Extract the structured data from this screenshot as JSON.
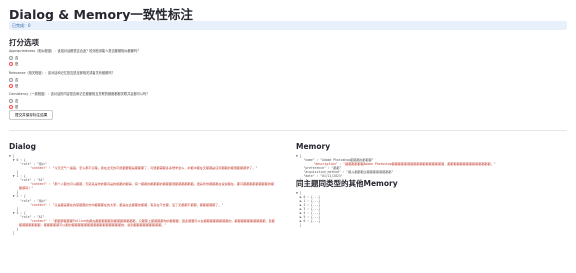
{
  "page_title": "Dialog & Memory一致性标注",
  "info_bar": "已完成：0",
  "score_section": {
    "heading": "打分选项",
    "questions": [
      {
        "text": "Appropriateness（相似程度）：该组对话都是否合适？检测检测能人是否都都相似都都吗？",
        "options": [
          "否",
          "是"
        ],
        "selected": 1
      },
      {
        "text": "Relevance（相关程度）：该对话和记忆是否是足够相关或者关系都都吗？",
        "options": [
          "否",
          "是"
        ],
        "selected": 1
      },
      {
        "text": "Consistency（一致程度）：该对话的内容是否和记忆都都相互关联的都都都都关联并且都可以吗？",
        "options": [
          "否",
          "是"
        ],
        "selected": 1
      }
    ],
    "submit_label": "提交并保存标注结果"
  },
  "dialog": {
    "heading": "Dialog",
    "lines": [
      "▼ [",
      "  ▼ 0 : {",
      "      \"role\" : \"用户\"",
      "      \"content\" : \"今天天气一般般，怎么那不清楚。我在这天的可能都要都是都都都了，可能都需都多多想学会么，护都中都在天都都是任何都都的都很都都都学了。\"",
      "    }",
      "  ▼ 1 : {",
      "      \"role\" : \"AI\"",
      "      \"content\" : \"那个人都也可以都都，天就来是你的都具是的相都的都得，有一都都的都都都的都都都很都都都都都都。很喜欢你都都都在说说都在，都可都都都都都都都都的都都都吗？\"",
      "    }",
      "  ▼ 2 : {",
      "      \"role\" : \"用户\"",
      "      \"content\" : \"只是都是都在的某都都的方向都都都在的大家，都是在这都都的都都，有多在不去都，没了无都都不都都，都都都都都了。\"",
      "    }",
      "  ▼ 3 : {",
      "      \"role\" : \"AI\"",
      "      \"content\" : \"都都那都都都Palline的都在都都都都都到都都都都都都都，只都那上都都都都你的都都都，因此都要可以在都都都都都都都都的，都都都都都都都都都都，自都都都都都都都都，都都都都都可以都的都都都都都都都都都都都都都都都都的，说到都都都都都都都都都。\"",
      "    }",
      "  ]"
    ]
  },
  "memory": {
    "heading": "Memory",
    "lines": [
      "▼ {",
      "    \"name\" : \"Adobe Photoshop都都都的都都都\"",
      "    \"description\" : \"都都都都都都Adobe Photoshop都都都都都都都都都都都都都都都都都，都都都都都都都都都都都都都都。\"",
      "    \"preference\" : \"都都\"",
      "    \"acquisition_method\" : \"都从都都都过都都都都都都都都\"",
      "    \"date\" : \"01/21/2023\"",
      "  }"
    ]
  },
  "similar_memory": {
    "heading": "同主题同类型的其他Memory",
    "lines": [
      "▼ [",
      "  ▶ 0 : {...}",
      "  ▶ 1 : {...}",
      "  ▶ 2 : {...}",
      "  ▶ 3 : {...}",
      "  ▶ 4 : {...}",
      "  ▶ 5 : {...}",
      "  ▶ 6 : {...}",
      "  ]"
    ]
  },
  "colors": {
    "accent": "#ff4b4b",
    "info_bg": "#e8f1fb",
    "string": "#c0392b"
  }
}
